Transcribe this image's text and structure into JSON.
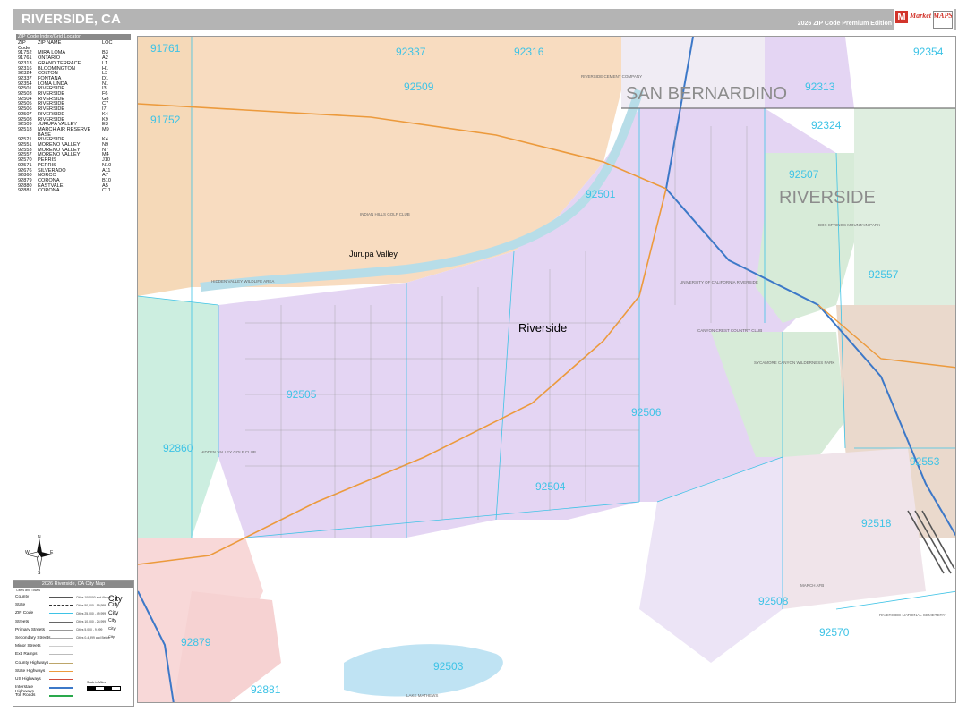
{
  "header": {
    "title": "RIVERSIDE, CA",
    "edition": "2026 ZIP Code Premium Edition",
    "logo_text": "Market MAPS",
    "logo_mark": "M"
  },
  "index": {
    "title": "ZIP Code Index/Grid Locator",
    "columns": [
      "ZIP Code",
      "ZIP NAME",
      "LOC"
    ],
    "rows": [
      [
        "91752",
        "MIRA LOMA",
        "B3"
      ],
      [
        "91761",
        "ONTARIO",
        "A2"
      ],
      [
        "92313",
        "GRAND TERRACE",
        "L1"
      ],
      [
        "92316",
        "BLOOMINGTON",
        "H1"
      ],
      [
        "92324",
        "COLTON",
        "L3"
      ],
      [
        "92337",
        "FONTANA",
        "D1"
      ],
      [
        "92354",
        "LOMA LINDA",
        "N1"
      ],
      [
        "92501",
        "RIVERSIDE",
        "I3"
      ],
      [
        "92503",
        "RIVERSIDE",
        "F6"
      ],
      [
        "92504",
        "RIVERSIDE",
        "G8"
      ],
      [
        "92505",
        "RIVERSIDE",
        "C7"
      ],
      [
        "92506",
        "RIVERSIDE",
        "I7"
      ],
      [
        "92507",
        "RIVERSIDE",
        "K4"
      ],
      [
        "92508",
        "RIVERSIDE",
        "K9"
      ],
      [
        "92509",
        "JURUPA VALLEY",
        "E3"
      ],
      [
        "92518",
        "MARCH AIR RESERVE BASE",
        "M9"
      ],
      [
        "92521",
        "RIVERSIDE",
        "K4"
      ],
      [
        "92551",
        "MORENO VALLEY",
        "N9"
      ],
      [
        "92553",
        "MORENO VALLEY",
        "N7"
      ],
      [
        "92557",
        "MORENO VALLEY",
        "M4"
      ],
      [
        "92570",
        "PERRIS",
        "J10"
      ],
      [
        "92571",
        "PERRIS",
        "N10"
      ],
      [
        "92676",
        "SILVERADO",
        "A11"
      ],
      [
        "92860",
        "NORCO",
        "A7"
      ],
      [
        "92879",
        "CORONA",
        "B10"
      ],
      [
        "92880",
        "EASTVALE",
        "A5"
      ],
      [
        "92881",
        "CORONA",
        "C11"
      ]
    ]
  },
  "map": {
    "county_labels": [
      "SAN BERNARDINO",
      "RIVERSIDE"
    ],
    "city_labels": [
      "Riverside",
      "Jurupa Valley"
    ],
    "zip_labels": [
      "91761",
      "92337",
      "92316",
      "92354",
      "92509",
      "92313",
      "91752",
      "92324",
      "92501",
      "92507",
      "92557",
      "92505",
      "92506",
      "92860",
      "92504",
      "92553",
      "92518",
      "92879",
      "92508",
      "92570",
      "92503",
      "92881"
    ],
    "place_labels": [
      "INDIAN HILLS GOLF CLUB",
      "UNIVERSITY OF CALIFORNIA RIVERSIDE",
      "CANYON CREST COUNTRY CLUB",
      "SYCAMORE CANYON WILDERNESS PARK",
      "BOX SPRINGS MOUNTAIN PARK",
      "HIDDEN VALLEY WILDLIFE AREA",
      "HIDDEN VALLEY GOLF CLUB",
      "RIVERSIDE NATIONAL CEMETERY",
      "RIVERSIDE CEMENT COMPANY",
      "MARCH AFB",
      "LAKE MATHEWS"
    ],
    "colors": {
      "zip_label": "#3ec3e6",
      "purple_zone": "#e4d5f3",
      "orange_zone": "#f8dcc0",
      "green_zone": "#d7ebd8",
      "mint_zone": "#cceee0",
      "pink_zone": "#f8d8d8",
      "tan_zone": "#ead9cc",
      "highway": "#ec9a3c",
      "interstate": "#3c78c8",
      "river": "#67c8e8"
    }
  },
  "legend": {
    "title": "2026 Riverside, CA City Map",
    "subtitle_left": "Cities and Towns",
    "rows": [
      "County",
      "State",
      "ZIP Code",
      "Streets",
      "Primary Streets",
      "Secondary Streets",
      "Minor Streets",
      "Exit Ramps",
      "County Highways",
      "State Highways",
      "US Highways",
      "Interstate Highways",
      "Toll Roads"
    ],
    "pop_labels": [
      "Cities 100,000 and Above",
      "Cities 50,000 - 99,999",
      "Cities 25,000 - 49,999",
      "Cities 10,000 - 24,999",
      "Cities 5,000 - 9,999",
      "Cities 0-4,999 and Below"
    ],
    "city_samples": [
      "City",
      "City",
      "City",
      "City",
      "City",
      "City"
    ],
    "scale_text": "Scale in Miles"
  },
  "compass": {
    "n": "N",
    "s": "S",
    "e": "E",
    "w": "W"
  }
}
